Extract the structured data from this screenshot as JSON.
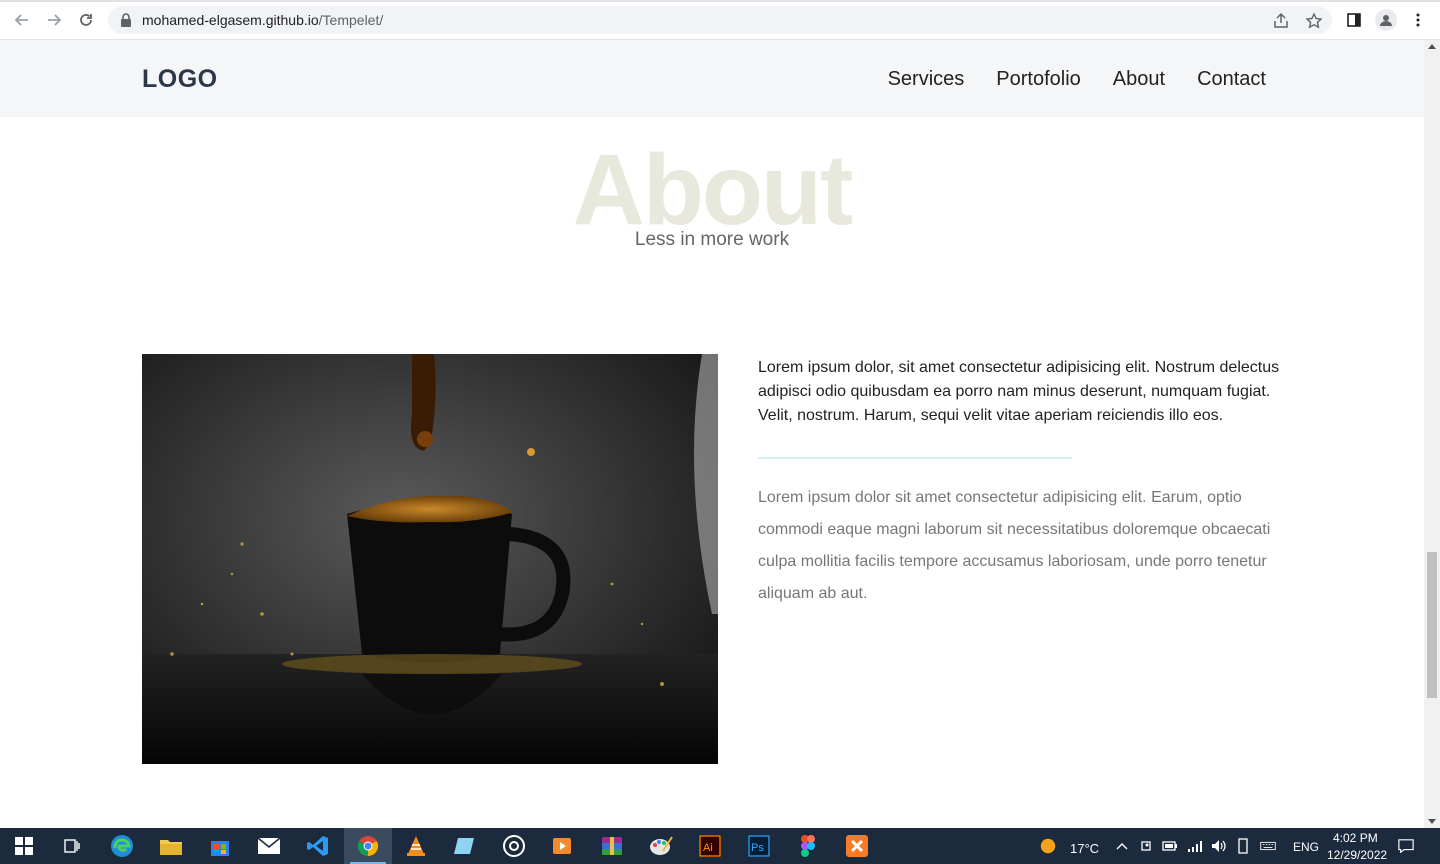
{
  "browser": {
    "url_domain": "mohamed-elgasem.github.io",
    "url_path": "/Tempelet/"
  },
  "site": {
    "logo": "LOGO",
    "nav": [
      "Services",
      "Portofolio",
      "About",
      "Contact"
    ]
  },
  "about": {
    "heading_bg": "About",
    "subtitle": "Less in more work",
    "lead": "Lorem ipsum dolor, sit amet consectetur adipisicing elit. Nostrum delectus adipisci odio quibusdam ea porro nam minus deserunt, numquam fugiat. Velit, nostrum. Harum, sequi velit vitae aperiam reiciendis illo eos.",
    "body": "Lorem ipsum dolor sit amet consectetur adipisicing elit. Earum, optio commodi eaque magni laborum sit necessitatibus doloremque obcaecati culpa mollitia facilis tempore accusamus laboriosam, unde porro tenetur aliquam ab aut.",
    "image": "coffee-cup-splash-photo"
  },
  "taskbar": {
    "weather_temp": "17°C",
    "language": "ENG",
    "time": "4:02 PM",
    "date": "12/29/2022",
    "apps": [
      "windows-start-icon",
      "task-view-icon",
      "edge-icon",
      "file-explorer-icon",
      "store-icon",
      "mail-icon",
      "vscode-icon",
      "chrome-icon",
      "vlc-icon",
      "app-icon",
      "obs-icon",
      "media-player-icon",
      "winrar-icon",
      "paint-icon",
      "illustrator-icon",
      "photoshop-icon",
      "figma-icon",
      "xampp-icon"
    ]
  },
  "colors": {
    "header_bg": "#f5f6f8",
    "about_watermark": "#e9e8dc",
    "divider": "#cfeff1",
    "taskbar_bg": "#1c2a3d"
  }
}
